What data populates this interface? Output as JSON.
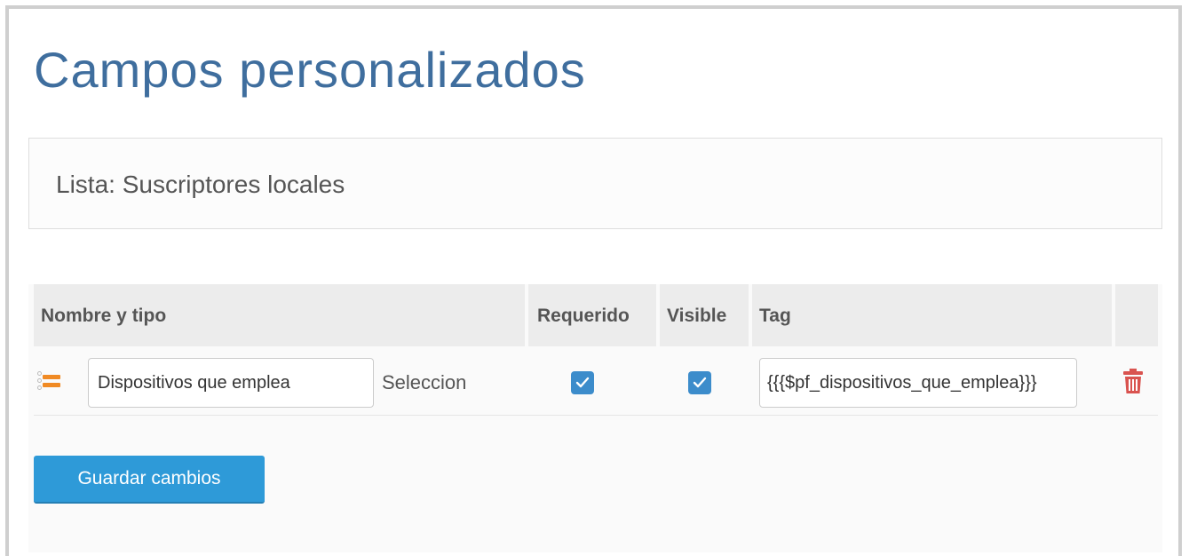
{
  "page": {
    "title": "Campos personalizados"
  },
  "list": {
    "label": "Lista: Suscriptores locales"
  },
  "table": {
    "headers": {
      "name_type": "Nombre y tipo",
      "required": "Requerido",
      "visible": "Visible",
      "tag": "Tag"
    },
    "rows": [
      {
        "name": "Dispositivos que emplea",
        "type": "Seleccion",
        "required": true,
        "visible": true,
        "tag": "{{{$pf_dispositivos_que_emplea}}}"
      }
    ]
  },
  "actions": {
    "save_label": "Guardar cambios"
  },
  "icons": {
    "drag": "drag-handle-icon",
    "check": "check-icon",
    "delete": "trash-icon"
  },
  "colors": {
    "title": "#3f6e9e",
    "accent": "#2e9ad8",
    "checkbox": "#3c8ccb",
    "delete": "#d9534f",
    "drag": "#f08a24"
  }
}
